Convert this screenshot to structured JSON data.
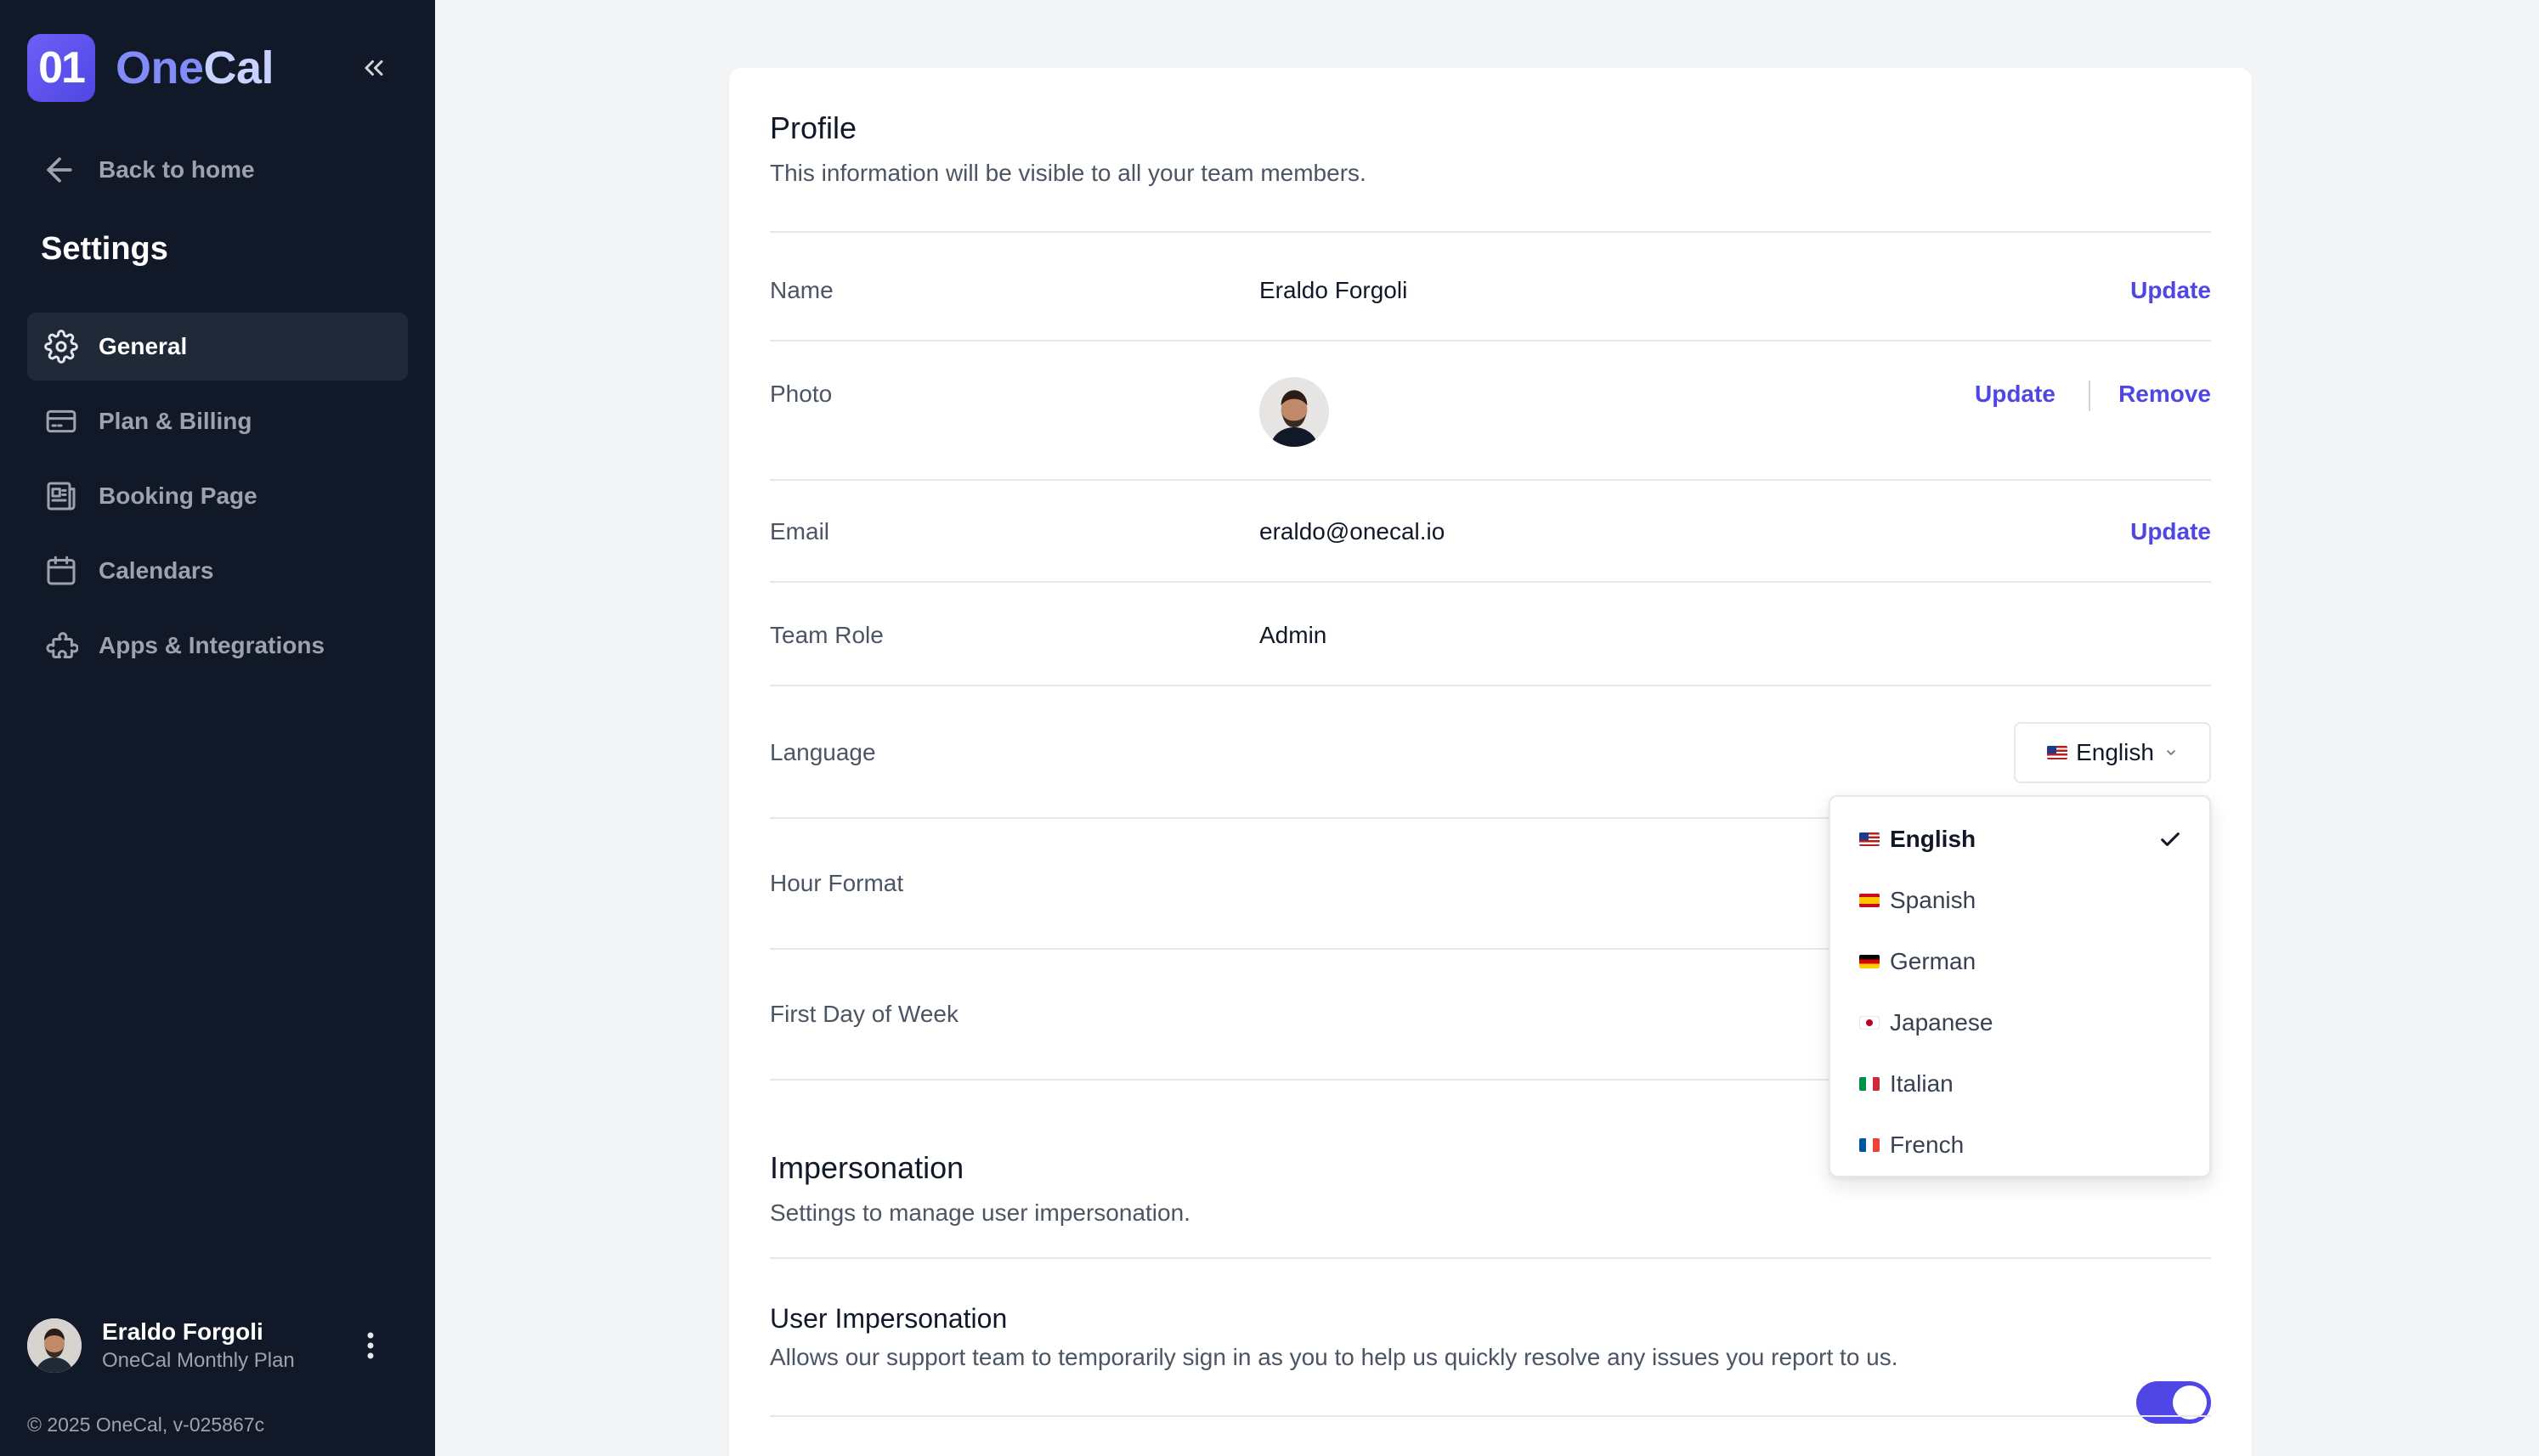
{
  "sidebar": {
    "logo_mark": "01",
    "logo_one": "One",
    "logo_cal": "Cal",
    "back_label": "Back to home",
    "settings_title": "Settings",
    "items": [
      {
        "label": "General",
        "icon": "gear-icon",
        "active": true
      },
      {
        "label": "Plan & Billing",
        "icon": "credit-card-icon",
        "active": false
      },
      {
        "label": "Booking Page",
        "icon": "booking-page-icon",
        "active": false
      },
      {
        "label": "Calendars",
        "icon": "calendar-icon",
        "active": false
      },
      {
        "label": "Apps & Integrations",
        "icon": "puzzle-icon",
        "active": false
      }
    ],
    "user": {
      "name": "Eraldo Forgoli",
      "plan": "OneCal Monthly Plan"
    },
    "copyright": "© 2025 OneCal, v-025867c"
  },
  "profile": {
    "title": "Profile",
    "subtitle": "This information will be visible to all your team members.",
    "name_label": "Name",
    "name_value": "Eraldo Forgoli",
    "photo_label": "Photo",
    "email_label": "Email",
    "email_value": "eraldo@onecal.io",
    "role_label": "Team Role",
    "role_value": "Admin",
    "language_label": "Language",
    "language_selected": "English",
    "hour_format_label": "Hour Format",
    "first_day_label": "First Day of Week",
    "update_label": "Update",
    "remove_label": "Remove"
  },
  "language_options": [
    "English",
    "Spanish",
    "German",
    "Japanese",
    "Italian",
    "French"
  ],
  "impersonation": {
    "title": "Impersonation",
    "subtitle": "Settings to manage user impersonation.",
    "user_title": "User Impersonation",
    "user_desc": "Allows our support team to temporarily sign in as you to help us quickly resolve any issues you report to us.",
    "enabled": true
  },
  "colors": {
    "accent": "#4f46e5",
    "sidebar_bg": "#111827",
    "page_bg": "#f3f4f6"
  }
}
